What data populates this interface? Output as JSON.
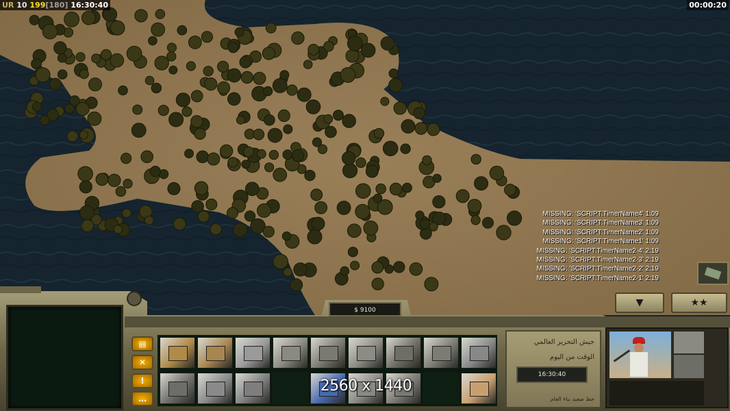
{
  "hud": {
    "faction": "UR",
    "level": "10",
    "units": "199",
    "unit_cap": "[180]",
    "clock": "16:30:40",
    "game_timer": "00:00:20"
  },
  "debug_messages": [
    "MISSING: 'SCRIPT:TimerName4' 1:09",
    "MISSING: 'SCRIPT:TimerName3' 1:09",
    "MISSING: 'SCRIPT:TimerName2' 1:09",
    "MISSING: 'SCRIPT:TimerName1' 1:09",
    "MISSING: 'SCRIPT:TimerName2-4' 2:19",
    "MISSING: 'SCRIPT:TimerName2-3' 2:19",
    "MISSING: 'SCRIPT:TimerName2-2' 2:19",
    "MISSING: 'SCRIPT:TimerName2-1' 2:19"
  ],
  "money": "$ 9100",
  "watermark": "2560 x 1440",
  "general_panel": {
    "line1": "جيش التحرير العالمي",
    "line2": "الوقت من اليوم",
    "clock": "16:30:40",
    "footer": "خط صعيد بناء العام"
  },
  "tabs": [
    {
      "icon": "structure-icon",
      "glyph": "▤"
    },
    {
      "icon": "wrench-icon",
      "glyph": "✕"
    },
    {
      "icon": "alert-icon",
      "glyph": "!"
    },
    {
      "icon": "chat-icon",
      "glyph": "…"
    }
  ],
  "build_buttons": [
    {
      "name": "build-command-center-button",
      "color": "#b08a48"
    },
    {
      "name": "build-barracks-button",
      "color": "#a88650"
    },
    {
      "name": "build-power-plant-button",
      "color": "#9a9a9a"
    },
    {
      "name": "build-supply-button",
      "color": "#8a8a82"
    },
    {
      "name": "build-war-factory-button",
      "color": "#7a7a72"
    },
    {
      "name": "build-airfield-button",
      "color": "#8c8c84"
    },
    {
      "name": "build-artillery-button",
      "color": "#6e6e66"
    },
    {
      "name": "build-depot-button",
      "color": "#7c7c74"
    },
    {
      "name": "build-defense-button",
      "color": "#888"
    },
    {
      "name": "build-vehicle-button",
      "color": "#6e6e68"
    },
    {
      "name": "build-bunker-button",
      "color": "#8a8a8a"
    },
    {
      "name": "build-tower-button",
      "color": "#7e7e7e"
    },
    {
      "name": "empty-slot",
      "color": ""
    },
    {
      "name": "build-radar-button",
      "color": "#4a6ab0"
    },
    {
      "name": "build-gun-button",
      "color": "#8a8a82"
    },
    {
      "name": "build-wall-button",
      "color": "#7a7a72"
    },
    {
      "name": "empty-slot",
      "color": ""
    },
    {
      "name": "build-map-button",
      "color": "#c8a070"
    }
  ]
}
